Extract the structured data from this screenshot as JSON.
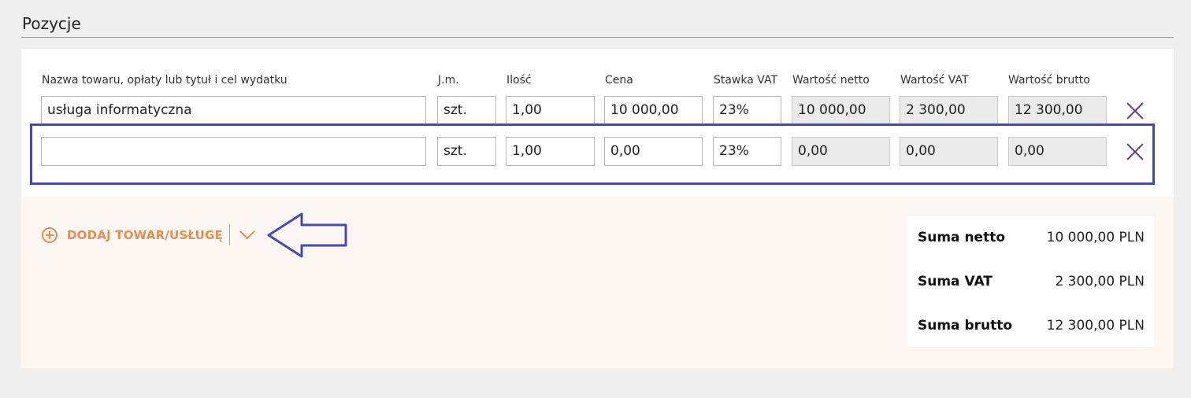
{
  "section": {
    "title": "Pozycje"
  },
  "columns": {
    "name": "Nazwa towaru, opłaty lub tytuł i cel wydatku",
    "unit": "J.m.",
    "qty": "Ilość",
    "price": "Cena",
    "vat_rate": "Stawka VAT",
    "net": "Wartość netto",
    "vat": "Wartość VAT",
    "gross": "Wartość brutto"
  },
  "rows": [
    {
      "name": "usługa informatyczna",
      "unit": "szt.",
      "qty": "1,00",
      "price": "10 000,00",
      "vat_rate": "23%",
      "net": "10 000,00",
      "vat": "2 300,00",
      "gross": "12 300,00"
    },
    {
      "name": "",
      "unit": "szt.",
      "qty": "1,00",
      "price": "0,00",
      "vat_rate": "23%",
      "net": "0,00",
      "vat": "0,00",
      "gross": "0,00"
    }
  ],
  "actions": {
    "add_label": "DODAJ TOWAR/USŁUGĘ"
  },
  "summary": {
    "net_label": "Suma netto",
    "net_value": "10 000,00 PLN",
    "vat_label": "Suma VAT",
    "vat_value": "2 300,00 PLN",
    "gross_label": "Suma brutto",
    "gross_value": "12 300,00 PLN"
  },
  "icons": {
    "delete": "close-icon",
    "add": "plus-circle-icon",
    "dropdown": "chevron-down-icon",
    "annotation": "arrow-left-icon"
  },
  "colors": {
    "accent": "#e98c50",
    "highlight": "#4848b4",
    "delete_icon": "#5b3f86",
    "readonly_bg": "#ebebeb",
    "panel_bg": "#fdf7f3"
  }
}
